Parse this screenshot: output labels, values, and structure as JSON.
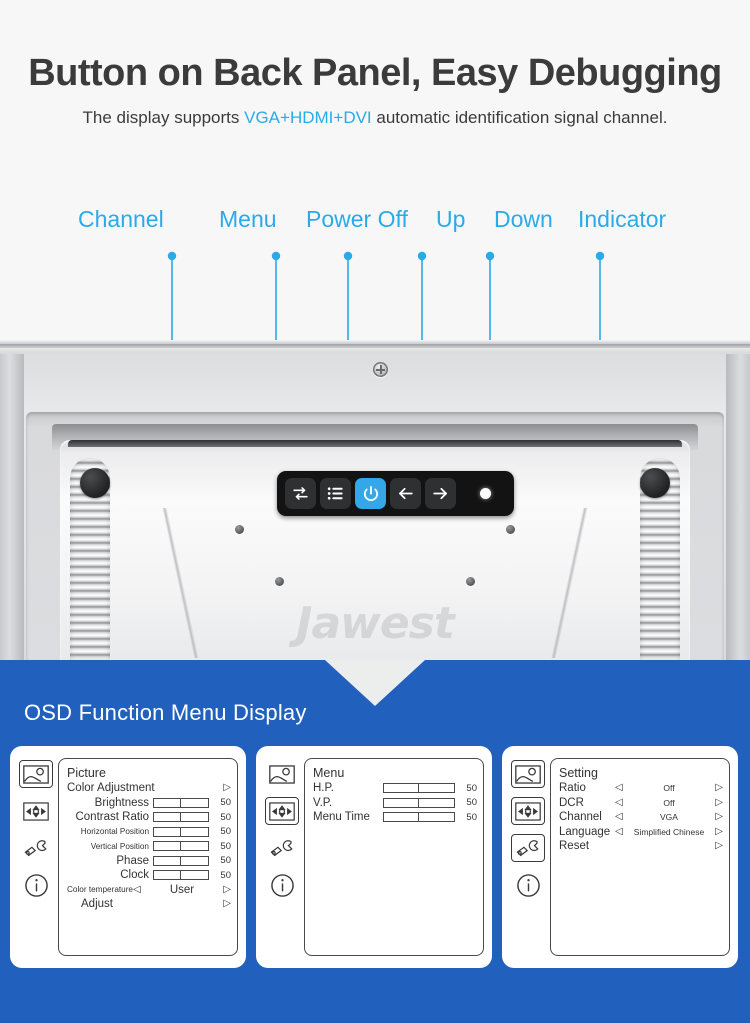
{
  "header": {
    "title": "Button on Back Panel, Easy Debugging",
    "subtitle_pre": "The display supports ",
    "subtitle_highlight": "VGA+HDMI+DVI",
    "subtitle_post": " automatic identification signal channel."
  },
  "colors": {
    "label_blue": "#29abe8",
    "banner_blue": "#2160bd",
    "power_button_blue": "#33a7e8",
    "background": "#f7f7f7"
  },
  "callouts": [
    {
      "label": "Channel",
      "icon": "swap-arrows-icon"
    },
    {
      "label": "Menu",
      "icon": "list-menu-icon"
    },
    {
      "label": "Power Off",
      "icon": "power-icon"
    },
    {
      "label": "Up",
      "icon": "arrow-left-icon"
    },
    {
      "label": "Down",
      "icon": "arrow-right-icon"
    },
    {
      "label": "Indicator",
      "icon": "led-dot-icon"
    }
  ],
  "monitor": {
    "watermark": "Jawest"
  },
  "osd": {
    "heading": "OSD Function Menu Display",
    "sidebar_icons": [
      "picture-icon",
      "position-icon",
      "tools-icon",
      "info-icon"
    ],
    "panels": [
      {
        "name": "picture-panel",
        "title": "Picture",
        "selected_icon_index": 0,
        "rows": [
          {
            "label": "Color Adjustment",
            "type": "arrow",
            "right_arrow": "▷"
          },
          {
            "label": "Brightness",
            "type": "bar",
            "value": "50"
          },
          {
            "label": "Contrast Ratio",
            "type": "bar",
            "value": "50"
          },
          {
            "label": "Horizontal Position",
            "type": "bar",
            "value": "50",
            "small": true
          },
          {
            "label": "Vertical Position",
            "type": "bar",
            "value": "50",
            "small": true
          },
          {
            "label": "Phase",
            "type": "bar",
            "value": "50"
          },
          {
            "label": "Clock",
            "type": "bar",
            "value": "50"
          },
          {
            "label": "Color temperature",
            "type": "option",
            "option": "User",
            "left_arrow": "◁",
            "right_arrow": "▷",
            "small": true
          },
          {
            "label": "Adjust",
            "type": "arrow",
            "right_arrow": "▷"
          }
        ]
      },
      {
        "name": "menu-panel",
        "title": "Menu",
        "selected_icon_index": 1,
        "rows": [
          {
            "label": "H.P.",
            "type": "bar",
            "value": "50"
          },
          {
            "label": "V.P.",
            "type": "bar",
            "value": "50"
          },
          {
            "label": "Menu Time",
            "type": "bar",
            "value": "50"
          }
        ]
      },
      {
        "name": "setting-panel",
        "title": "Setting",
        "selected_icon_index": 2,
        "rows": [
          {
            "label": "Ratio",
            "type": "option",
            "option": "Off",
            "left_arrow": "◁",
            "right_arrow": "▷"
          },
          {
            "label": "DCR",
            "type": "option",
            "option": "Off",
            "left_arrow": "◁",
            "right_arrow": "▷"
          },
          {
            "label": "Channel",
            "type": "option",
            "option": "VGA",
            "left_arrow": "◁",
            "right_arrow": "▷"
          },
          {
            "label": "Language",
            "type": "option",
            "option": "Simplified Chinese",
            "left_arrow": "◁",
            "right_arrow": "▷"
          },
          {
            "label": "Reset",
            "type": "arrow",
            "right_arrow": "▷"
          }
        ]
      }
    ]
  }
}
